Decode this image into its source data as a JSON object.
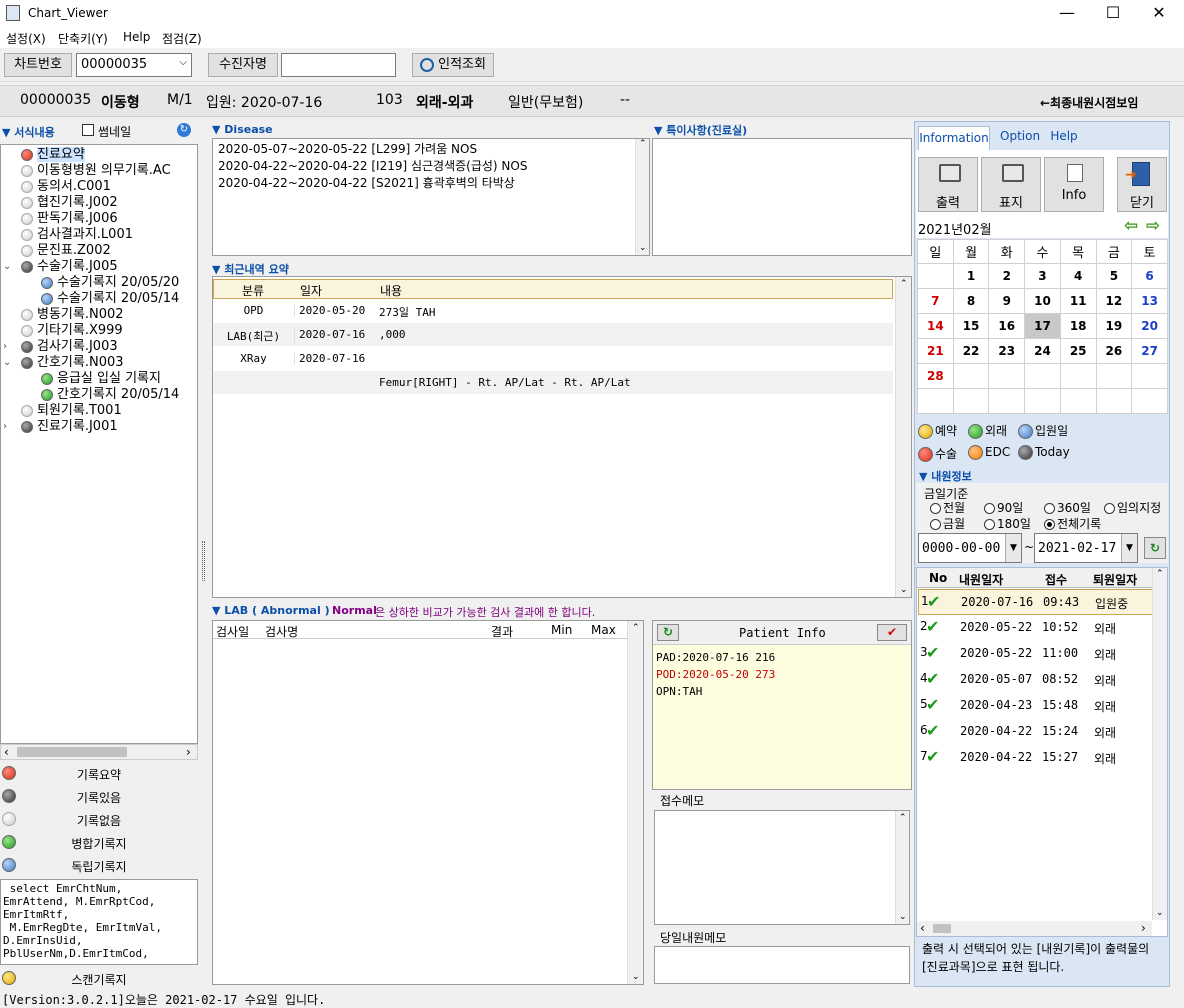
{
  "window": {
    "title": "Chart_Viewer",
    "minimize": "—",
    "maximize": "☐",
    "close": "✕"
  },
  "menu": [
    "설정(X)",
    "단축키(Y)",
    "Help",
    "점검(Z)"
  ],
  "toolbar": {
    "chart_no_label": "차트번호",
    "chart_no_value": "00000035",
    "patient_name_label": "수진자명",
    "patient_name_value": "",
    "lookup_button": "인적조회"
  },
  "patient": {
    "id": "00000035",
    "name": "이동형",
    "sex_age": "M/1",
    "admit": "입원: 2020-07-16",
    "room": "103",
    "dept": "외래-외과",
    "insurance": "일반(무보험)",
    "dash": "--",
    "latest_link": "←최종내원시점보임"
  },
  "left": {
    "header": "▼ 서식내용",
    "thumbnail_label": "썸네일",
    "tree": [
      {
        "label": "진료요약",
        "icon": "c-red",
        "indent": 0,
        "sel": true
      },
      {
        "label": "이동형병원 의무기록.AC",
        "icon": "c-white",
        "indent": 0
      },
      {
        "label": "동의서.C001",
        "icon": "c-white",
        "indent": 0
      },
      {
        "label": "협진기록.J002",
        "icon": "c-white",
        "indent": 0
      },
      {
        "label": "판독기록.J006",
        "icon": "c-white",
        "indent": 0
      },
      {
        "label": "검사결과지.L001",
        "icon": "c-white",
        "indent": 0
      },
      {
        "label": "문진표.Z002",
        "icon": "c-white",
        "indent": 0
      },
      {
        "label": "수술기록.J005",
        "icon": "c-gray",
        "indent": 0,
        "exp": "v"
      },
      {
        "label": "수술기록지 20/05/20",
        "icon": "c-blue",
        "indent": 1
      },
      {
        "label": "수술기록지 20/05/14",
        "icon": "c-blue",
        "indent": 1
      },
      {
        "label": "병동기록.N002",
        "icon": "c-white",
        "indent": 0
      },
      {
        "label": "기타기록.X999",
        "icon": "c-white",
        "indent": 0
      },
      {
        "label": "검사기록.J003",
        "icon": "c-gray",
        "indent": 0,
        "exp": ">"
      },
      {
        "label": "간호기록.N003",
        "icon": "c-gray",
        "indent": 0,
        "exp": "v"
      },
      {
        "label": "응급실 입실 기록지",
        "icon": "c-green",
        "indent": 1
      },
      {
        "label": "간호기록지 20/05/14",
        "icon": "c-green",
        "indent": 1
      },
      {
        "label": "퇴원기록.T001",
        "icon": "c-white",
        "indent": 0
      },
      {
        "label": "진료기록.J001",
        "icon": "c-gray",
        "indent": 0,
        "exp": ">"
      }
    ],
    "legend": [
      {
        "label": "기록요약",
        "icon": "c-red"
      },
      {
        "label": "기록있음",
        "icon": "c-gray"
      },
      {
        "label": "기록없음",
        "icon": "c-white"
      },
      {
        "label": "병합기록지",
        "icon": "c-green"
      },
      {
        "label": "독립기록지",
        "icon": "c-blue"
      }
    ],
    "sql": " select EmrChtNum,\nEmrAttend, M.EmrRptCod,\nEmrItmRtf,\n M.EmrRegDte, EmrItmVal,\nD.EmrInsUid,\nPblUserNm,D.EmrItmCod,\n",
    "scan_label": "스캔기록지"
  },
  "disease": {
    "header": "▼ Disease",
    "items": [
      "2020-05-07~2020-05-22 [L299] 가려움 NOS",
      "2020-04-22~2020-04-22 [I219] 심근경색증(급성) NOS",
      "2020-04-22~2020-04-22 [S2021] 흉곽후벽의 타박상"
    ]
  },
  "special": {
    "header": "▼ 특이사항(진료실)"
  },
  "recent": {
    "header": "▼ 최근내역 요약",
    "columns": [
      "분류",
      "일자",
      "내용"
    ],
    "rows": [
      [
        "OPD",
        "2020-05-20",
        "273일  TAH"
      ],
      [
        "LAB(최근)",
        "2020-07-16",
        ",000"
      ],
      [
        "XRay",
        "2020-07-16",
        ""
      ],
      [
        "",
        "",
        "Femur[RIGHT] - Rt. AP/Lat - Rt. AP/Lat"
      ]
    ]
  },
  "lab": {
    "header": "▼ LAB ( Abnormal )",
    "normal_word": "Normal",
    "note": " 은 상하한 비교가 가능한 검사 결과에 한 합니다.",
    "columns": [
      "검사일",
      "검사명",
      "결과",
      "Min",
      "Max"
    ]
  },
  "patient_info": {
    "title": "Patient Info",
    "lines": [
      {
        "t": "PAD:2020-07-16 216",
        "c": "#000"
      },
      {
        "t": "POD:2020-05-20 273",
        "c": "#c00000"
      },
      {
        "t": "OPN:TAH",
        "c": "#000"
      }
    ]
  },
  "memo": {
    "reception": "접수메모",
    "daily": "당일내원메모"
  },
  "right": {
    "tabs": [
      "Information",
      "Option",
      "Help"
    ],
    "buttons": [
      {
        "label": "출력",
        "icon": "printer-icon"
      },
      {
        "label": "표지",
        "icon": "printer-icon"
      },
      {
        "label": "Info",
        "icon": "info-icon"
      },
      {
        "label": "닫기",
        "icon": "exit-icon"
      }
    ],
    "month": "2021년02월",
    "weekdays": [
      "일",
      "월",
      "화",
      "수",
      "목",
      "금",
      "토"
    ],
    "weeks": [
      [
        "",
        "1",
        "2",
        "3",
        "4",
        "5",
        "6"
      ],
      [
        "7",
        "8",
        "9",
        "10",
        "11",
        "12",
        "13"
      ],
      [
        "14",
        "15",
        "16",
        "17",
        "18",
        "19",
        "20"
      ],
      [
        "21",
        "22",
        "23",
        "24",
        "25",
        "26",
        "27"
      ],
      [
        "28",
        "",
        "",
        "",
        "",
        "",
        ""
      ],
      [
        "",
        "",
        "",
        "",
        "",
        "",
        ""
      ]
    ],
    "legend1": [
      {
        "label": "예약",
        "icon": "c-yellow"
      },
      {
        "label": "외래",
        "icon": "c-green"
      },
      {
        "label": "입원일",
        "icon": "c-blue"
      }
    ],
    "legend2": [
      {
        "label": "수술",
        "icon": "c-red"
      },
      {
        "label": "EDC",
        "icon": "c-orange"
      },
      {
        "label": "Today",
        "icon": "c-gray"
      }
    ],
    "visit_header": "▼ 내원정보",
    "basis": "금일기준",
    "radios": [
      [
        "전월",
        "90일",
        "360일",
        "임의지정"
      ],
      [
        "금월",
        "180일",
        "전체기록"
      ]
    ],
    "date_from": "0000-00-00",
    "date_to": "2021-02-17",
    "tilde": "~",
    "visit_columns": [
      "No",
      "내원일자",
      "접수",
      "퇴원일자"
    ],
    "visits": [
      [
        "1",
        "2020-07-16",
        "09:43",
        "입원중"
      ],
      [
        "2",
        "2020-05-22",
        "10:52",
        "외래"
      ],
      [
        "3",
        "2020-05-22",
        "11:00",
        "외래"
      ],
      [
        "4",
        "2020-05-07",
        "08:52",
        "외래"
      ],
      [
        "5",
        "2020-04-23",
        "15:48",
        "외래"
      ],
      [
        "6",
        "2020-04-22",
        "15:24",
        "외래"
      ],
      [
        "7",
        "2020-04-22",
        "15:27",
        "외래"
      ]
    ],
    "note": "출력 시 선택되어 있는 [내원기록]이 출력물의 [진료과목]으로 표현 됩니다."
  },
  "status": "[Version:3.0.2.1]오늘은  2021-02-17 수요일 입니다."
}
